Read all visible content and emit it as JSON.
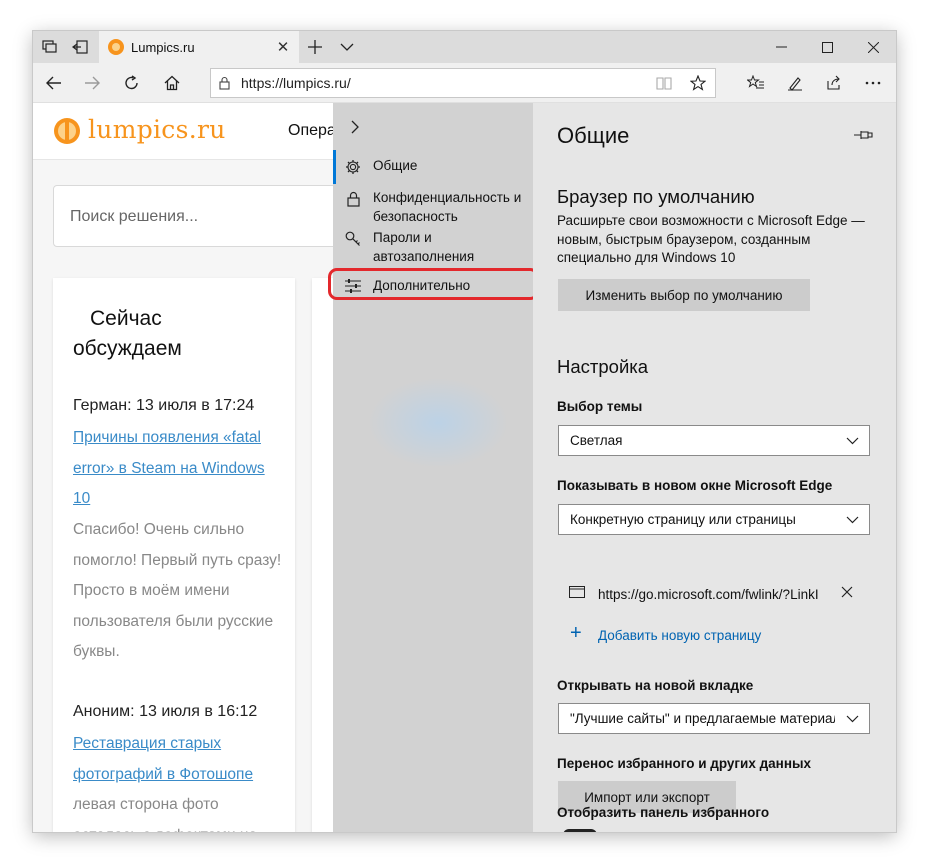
{
  "browser": {
    "tab_title": "Lumpics.ru",
    "url": "https://lumpics.ru/"
  },
  "site": {
    "logo_text": "lumpics.ru",
    "nav_partial": "Опера",
    "search_placeholder": "Поиск решения...",
    "card_title": "Сейчас обсуждаем",
    "comments": [
      {
        "author": "Герман: 13 июля в 17:24",
        "link": "Причины появления «fatal error» в Steam на Windows 10",
        "text": "Спасибо! Очень сильно помогло! Первый путь сразу! Просто в моём имени пользователя были русские буквы."
      },
      {
        "author": "Аноним: 13 июля в 16:12",
        "link": "Реставрация старых фотографий в Фотошопе",
        "text": "левая сторона фото осталась с дефектами на"
      }
    ]
  },
  "settings_menu": {
    "items": [
      {
        "label": "Общие",
        "icon": "gear-icon"
      },
      {
        "label": "Конфиденциальность и безопасность",
        "icon": "lock-icon"
      },
      {
        "label": "Пароли и автозаполнения",
        "icon": "key-icon"
      },
      {
        "label": "Дополнительно",
        "icon": "sliders-icon"
      }
    ]
  },
  "settings_panel": {
    "title": "Общие",
    "default_browser": {
      "heading": "Браузер по умолчанию",
      "description": "Расширьте свои возможности с Microsoft Edge — новым, быстрым браузером, созданным специально для Windows 10",
      "button": "Изменить выбор по умолчанию"
    },
    "customize": {
      "heading": "Настройка",
      "theme_label": "Выбор темы",
      "theme_value": "Светлая",
      "new_window_label": "Показывать в новом окне Microsoft Edge",
      "new_window_value": "Конкретную страницу или страницы",
      "page_url": "https://go.microsoft.com/fwlink/?LinkId=",
      "add_page": "Добавить новую страницу",
      "new_tab_label": "Открывать на новой вкладке",
      "new_tab_value": "\"Лучшие сайты\" и предлагаемые материалы",
      "transfer_label": "Перенос избранного и других данных",
      "import_button": "Импорт или экспорт",
      "favorites_bar_label": "Отобразить панель избранного"
    }
  },
  "colors": {
    "accent": "#0078d7",
    "brand_orange": "#f7941d",
    "link_blue": "#3a8bc8",
    "highlight_red": "#e3282c"
  }
}
